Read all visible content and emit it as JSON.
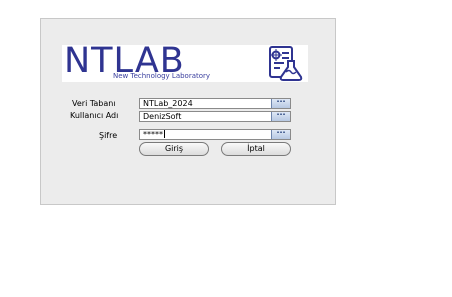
{
  "logo": {
    "word": "NTLAB",
    "tagline": "New Technology  Laboratory",
    "icon": "lab-flask-document-icon",
    "color": "#2f3491"
  },
  "form": {
    "database": {
      "label": "Veri Tabanı",
      "value": "NTLab_2024"
    },
    "username": {
      "label": "Kullanıcı Adı",
      "value": "DenizSoft"
    },
    "password": {
      "label": "Şifre",
      "value": "*****"
    },
    "ellipsis": "···"
  },
  "buttons": {
    "login": "Giriş",
    "cancel": "İptal"
  }
}
